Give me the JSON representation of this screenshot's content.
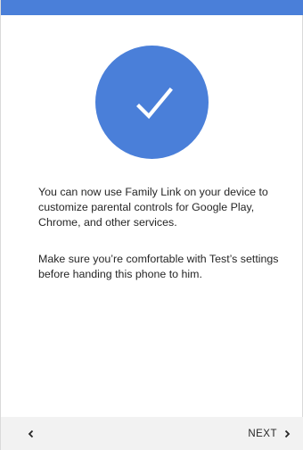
{
  "app": {
    "accent_color": "#4a7fd9",
    "bottom_bar_color": "#f2f2f2"
  },
  "hero": {
    "icon": "checkmark-icon"
  },
  "content": {
    "paragraph_1": "You can now use Family Link on your device to customize parental controls for Google Play, Chrome, and other services.",
    "paragraph_2": "Make sure you’re comfortable with Test’s settings before handing this phone to him."
  },
  "navigation": {
    "back_icon": "chevron-left-icon",
    "next_label": "NEXT",
    "next_icon": "chevron-right-icon"
  }
}
